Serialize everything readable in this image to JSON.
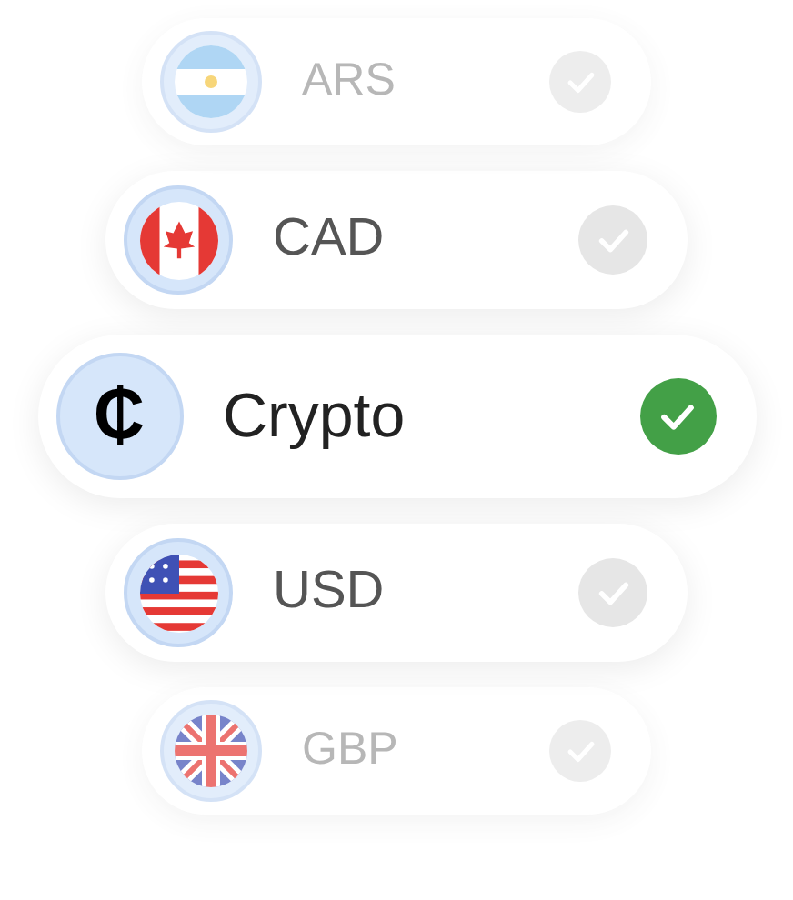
{
  "currencies": [
    {
      "code": "ARS",
      "kind": "flag",
      "selected": false
    },
    {
      "code": "CAD",
      "kind": "flag",
      "selected": false
    },
    {
      "code": "Crypto",
      "kind": "symbol",
      "symbol": "₵",
      "selected": true
    },
    {
      "code": "USD",
      "kind": "flag",
      "selected": false
    },
    {
      "code": "GBP",
      "kind": "flag",
      "selected": false
    }
  ]
}
